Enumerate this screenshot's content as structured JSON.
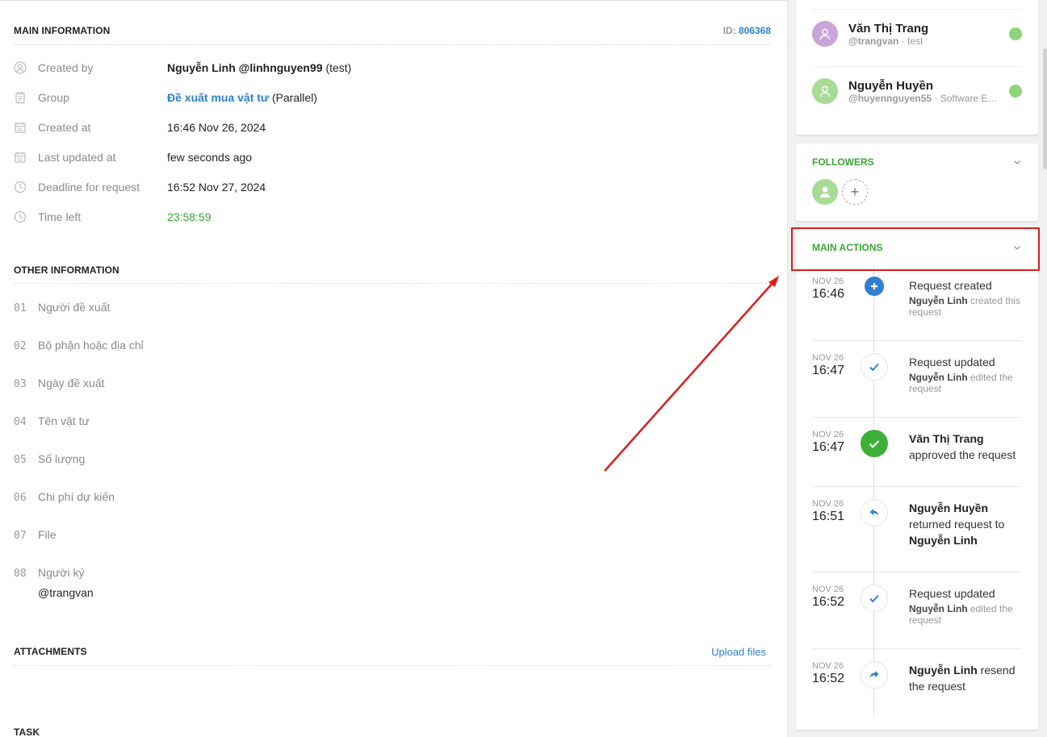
{
  "main_info": {
    "title": "MAIN INFORMATION",
    "id_prefix": "ID:",
    "id_value": "806368",
    "rows": [
      {
        "label": "Created by",
        "value_bold": "Nguyễn Linh @linhnguyen99",
        "value_rest": " (test)"
      },
      {
        "label": "Group",
        "value_link": "Đề xuất mua vật tư",
        "value_rest": " (Parallel)"
      },
      {
        "label": "Created at",
        "value": "16:46 Nov 26, 2024"
      },
      {
        "label": "Last updated at",
        "value": "few seconds ago"
      },
      {
        "label": "Deadline for request",
        "value": "16:52 Nov 27, 2024"
      },
      {
        "label": "Time left",
        "value": "23:58:59"
      }
    ]
  },
  "other_info": {
    "title": "OTHER INFORMATION",
    "fields": [
      {
        "num": "01",
        "label": "Người đề xuất"
      },
      {
        "num": "02",
        "label": "Bộ phận hoặc địa chỉ"
      },
      {
        "num": "03",
        "label": "Ngày đề xuất"
      },
      {
        "num": "04",
        "label": "Tên vật tư"
      },
      {
        "num": "05",
        "label": "Số lượng"
      },
      {
        "num": "06",
        "label": "Chi phí dự kiến"
      },
      {
        "num": "07",
        "label": "File"
      },
      {
        "num": "08",
        "label": "Người ký",
        "value": "@trangvan"
      }
    ]
  },
  "attachments": {
    "title": "ATTACHMENTS",
    "upload_label": "Upload files"
  },
  "task": {
    "title": "TASK"
  },
  "approvers": [
    {
      "name": "Văn Thị Trang",
      "handle": "@trangvan",
      "note": " · test",
      "avatar_color": "#c9a4d9"
    },
    {
      "name": "Nguyễn Huyền",
      "handle": "@huyennguyen55",
      "note": " · Software Eng...",
      "avatar_color": "#a8dc96"
    }
  ],
  "followers": {
    "title": "FOLLOWERS",
    "add_label": "+"
  },
  "main_actions": {
    "title": "MAIN ACTIONS",
    "items": [
      {
        "date": "NOV 26",
        "time": "16:46",
        "icon": "plus-icon",
        "line1": "Request created",
        "actor": "Nguyễn Linh",
        "desc": " created this request"
      },
      {
        "date": "NOV 26",
        "time": "16:47",
        "icon": "check-icon",
        "line1": "Request updated",
        "actor": "Nguyễn Linh",
        "desc": " edited the request"
      },
      {
        "date": "NOV 26",
        "time": "16:47",
        "icon": "approved-icon",
        "actor": "Văn Thị Trang",
        "desc": "approved the request"
      },
      {
        "date": "NOV 26",
        "time": "16:51",
        "icon": "return-icon",
        "actor": "Nguyễn Huyền",
        "desc": "returned request to",
        "target": "Nguyễn Linh"
      },
      {
        "date": "NOV 26",
        "time": "16:52",
        "icon": "check-icon",
        "line1": "Request updated",
        "actor": "Nguyễn Linh",
        "desc": " edited the request"
      },
      {
        "date": "NOV 26",
        "time": "16:52",
        "icon": "resend-icon",
        "actor": "Nguyễn Linh",
        "desc": " resend the request"
      }
    ]
  },
  "colors": {
    "accent": "#2f80d1",
    "green": "#3aa634",
    "highlight": "#e01b1b"
  }
}
